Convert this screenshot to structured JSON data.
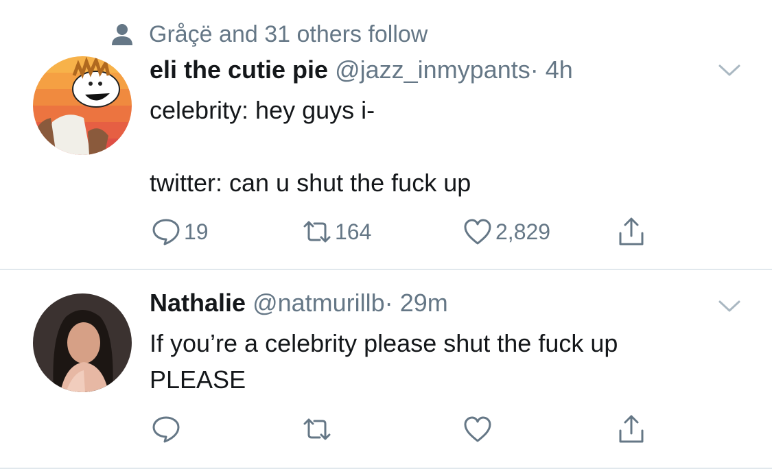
{
  "timeline": {
    "tweets": [
      {
        "social_context": "Gråçë and 31 others follow",
        "name": "eli the cutie pie",
        "handle": "@jazz_inmypants",
        "separator": "·",
        "time": "4h",
        "lines": [
          "celebrity: hey guys i-",
          "twitter: can u shut the fuck up"
        ],
        "replies": "19",
        "retweets": "164",
        "likes": "2,829"
      },
      {
        "name": "Nathalie",
        "handle": "@natmurillb",
        "separator": "·",
        "time": "29m",
        "lines": [
          "If you’re a celebrity please shut the fuck up",
          "PLEASE"
        ]
      }
    ]
  },
  "colors": {
    "text": "#14171a",
    "secondary": "#657786",
    "divider": "#e1e8ed",
    "background": "#ffffff"
  },
  "icons": [
    "person-icon",
    "chevron-down-icon",
    "reply-icon",
    "retweet-icon",
    "like-icon",
    "share-icon"
  ]
}
